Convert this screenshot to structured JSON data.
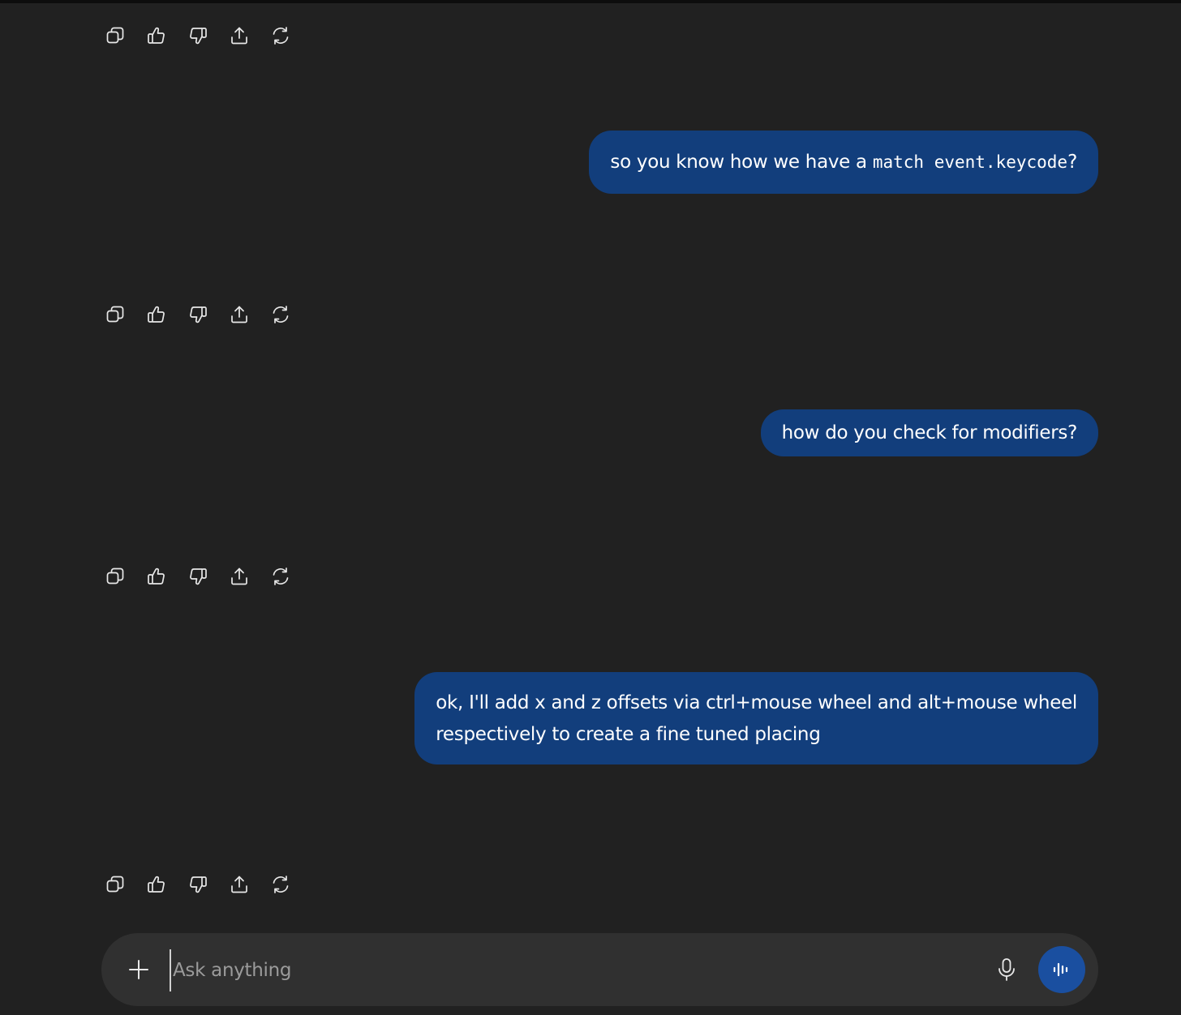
{
  "messages": [
    {
      "role": "user",
      "text_before": "so you know how we have a",
      "code": "match event.keycode",
      "text_after": "?"
    },
    {
      "role": "user",
      "text": "how do you check for modifiers?"
    },
    {
      "role": "user",
      "line1": "ok, I'll add x and z offsets via ctrl+mouse wheel and alt+mouse wheel",
      "line2": "respectively to create a fine tuned placing"
    }
  ],
  "action_icons": [
    "copy-icon",
    "thumbs-up-icon",
    "thumbs-down-icon",
    "share-icon",
    "regenerate-icon"
  ],
  "composer": {
    "placeholder": "Ask anything",
    "value": ""
  },
  "colors": {
    "background": "#212121",
    "user_bubble": "#123e7c",
    "composer": "#303030",
    "voice_button": "#1a4fa0"
  }
}
